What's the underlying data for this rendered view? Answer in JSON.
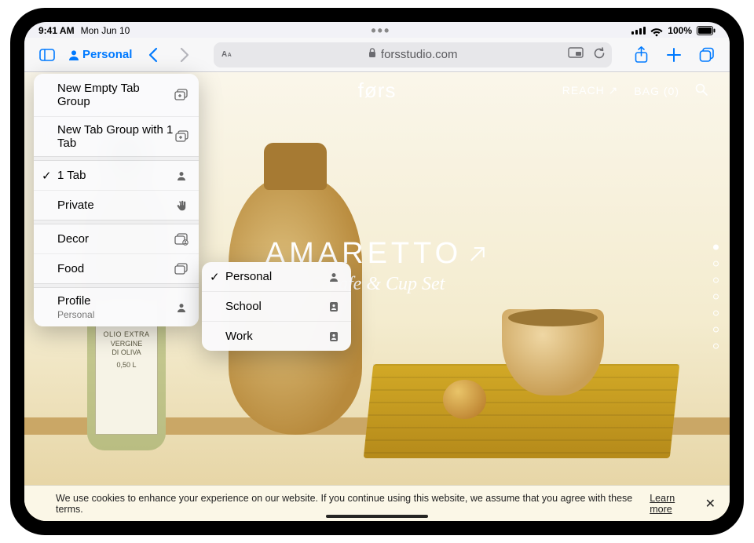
{
  "statusbar": {
    "time": "9:41 AM",
    "date": "Mon Jun 10",
    "battery_pct": "100%"
  },
  "toolbar": {
    "profile_label": "Personal",
    "url_host": "forsstudio.com"
  },
  "menu1": {
    "new_empty": "New Empty Tab Group",
    "new_with": "New Tab Group with 1 Tab",
    "one_tab": "1 Tab",
    "private": "Private",
    "decor": "Decor",
    "food": "Food",
    "profile_label": "Profile",
    "profile_sub": "Personal"
  },
  "menu2": {
    "items": [
      {
        "label": "Personal",
        "checked": true
      },
      {
        "label": "School",
        "checked": false
      },
      {
        "label": "Work",
        "checked": false
      }
    ]
  },
  "site": {
    "logo": "førs",
    "reach": "REACH ↗",
    "bag": "BAG (0)",
    "hero_title": "AMARETTO",
    "hero_sub": "Carafe & Cup Set",
    "bottle_label_1": "OLIO EXTRA",
    "bottle_label_2": "VERGINE",
    "bottle_label_3": "DI OLIVA",
    "bottle_label_4": "0,50 L"
  },
  "cookie": {
    "text": "We use cookies to enhance your experience on our website. If you continue using this website, we assume that you agree with these terms.",
    "learn": "Learn more"
  }
}
